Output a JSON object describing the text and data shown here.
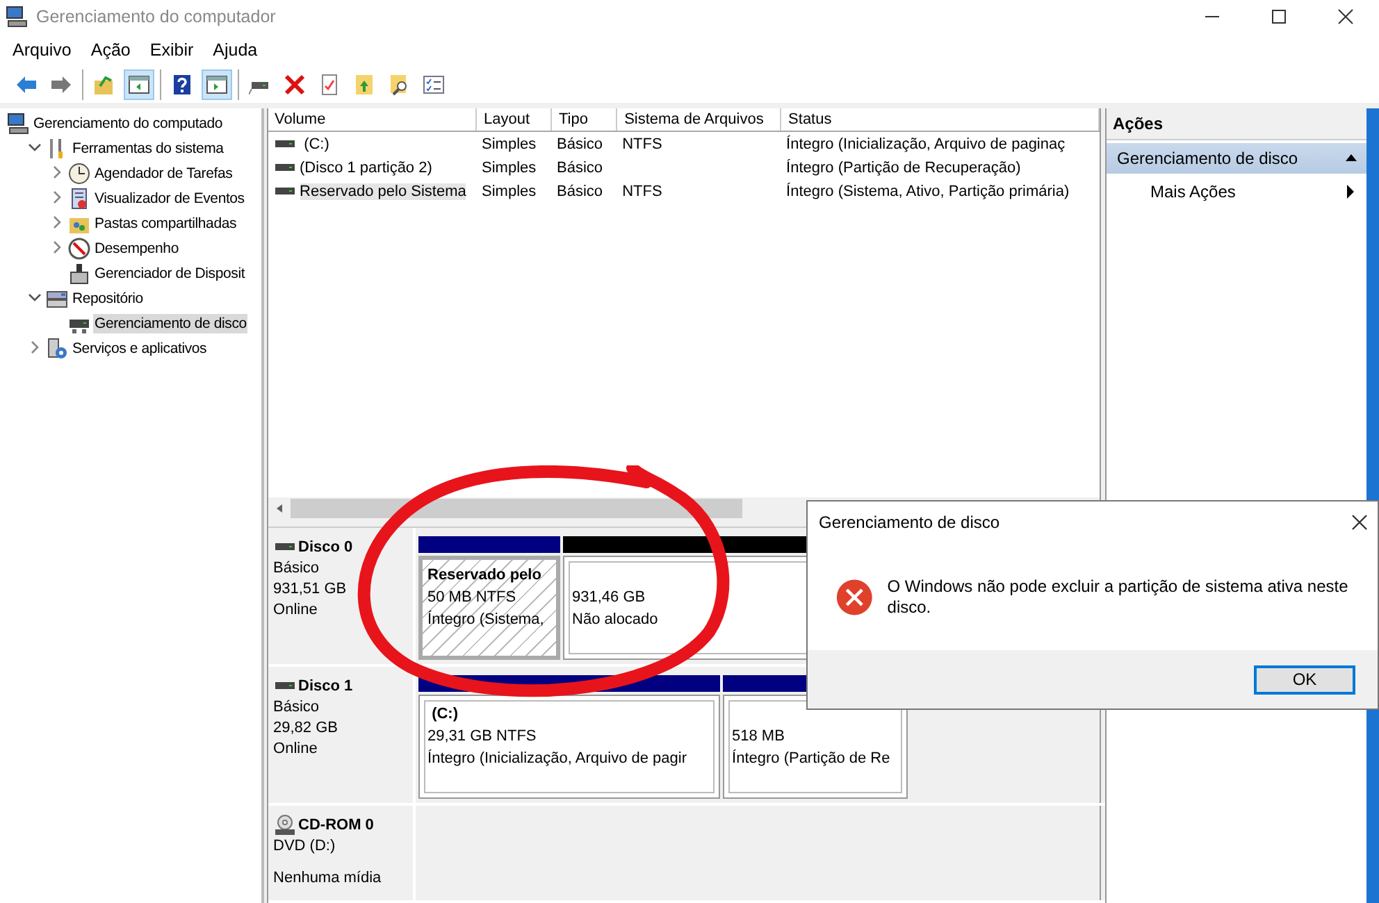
{
  "window": {
    "title": "Gerenciamento do computador"
  },
  "menu": [
    "Arquivo",
    "Ação",
    "Exibir",
    "Ajuda"
  ],
  "toolbar": [
    [
      {
        "kind": "back",
        "pressed": false
      },
      {
        "kind": "forward",
        "pressed": false
      }
    ],
    [
      {
        "kind": "up",
        "pressed": false
      },
      {
        "kind": "tree-pane",
        "pressed": true
      }
    ],
    [
      {
        "kind": "help",
        "pressed": false
      },
      {
        "kind": "action-pane",
        "pressed": true
      }
    ],
    [
      {
        "kind": "connect",
        "pressed": false
      },
      {
        "kind": "delete",
        "pressed": false
      },
      {
        "kind": "properties",
        "pressed": false
      },
      {
        "kind": "export",
        "pressed": false
      },
      {
        "kind": "find",
        "pressed": false
      },
      {
        "kind": "checklist",
        "pressed": false
      }
    ]
  ],
  "tree": [
    {
      "label": "Gerenciamento do computado",
      "kind": "computer",
      "selected": false,
      "children": [
        {
          "label": "Ferramentas do sistema",
          "kind": "tools",
          "expanded": true,
          "selected": false,
          "children": [
            {
              "label": "Agendador de Tarefas",
              "kind": "clock",
              "expanded": false,
              "selected": false
            },
            {
              "label": "Visualizador de Eventos",
              "kind": "log",
              "expanded": false,
              "selected": false
            },
            {
              "label": "Pastas compartilhadas",
              "kind": "share",
              "expanded": false,
              "selected": false
            },
            {
              "label": "Desempenho",
              "kind": "gauge",
              "expanded": false,
              "selected": false
            },
            {
              "label": "Gerenciador de Disposit",
              "kind": "device",
              "selected": false
            }
          ]
        },
        {
          "label": "Repositório",
          "kind": "storage",
          "expanded": true,
          "selected": false,
          "children": [
            {
              "label": "Gerenciamento de disco",
              "kind": "disk",
              "selected": true
            }
          ]
        },
        {
          "label": "Serviços e aplicativos",
          "kind": "services",
          "expanded": false,
          "selected": false
        }
      ]
    }
  ],
  "volume_table": {
    "columns": [
      "Volume",
      "Layout",
      "Tipo",
      "Sistema de Arquivos",
      "Status"
    ],
    "rows": [
      {
        "volume": " (C:)",
        "layout": "Simples",
        "type": "Básico",
        "file_system": "NTFS",
        "status": "Íntegro (Inicialização, Arquivo de paginaç",
        "selected": false
      },
      {
        "volume": "(Disco 1 partição 2)",
        "layout": "Simples",
        "type": "Básico",
        "status": "Íntegro (Partição de Recuperação)",
        "selected": false
      },
      {
        "volume": "Reservado pelo Sistema",
        "layout": "Simples",
        "type": "Básico",
        "file_system": "NTFS",
        "status": "Íntegro (Sistema, Ativo, Partição primária)",
        "selected": true
      }
    ]
  },
  "disks": [
    {
      "kind": "disk",
      "name": "Disco 0",
      "details": [
        "Básico",
        "931,51 GB",
        "Online"
      ],
      "partitions": [
        {
          "kind": "primary",
          "label": "Reservado pelo",
          "size": "50 MB NTFS",
          "status": "Íntegro (Sistema,",
          "selected": true
        },
        {
          "kind": "unallocated",
          "size": "931,46 GB",
          "status": "Não alocado",
          "selected": false
        }
      ]
    },
    {
      "kind": "disk",
      "name": "Disco 1",
      "details": [
        "Básico",
        "29,82 GB",
        "Online"
      ],
      "partitions": [
        {
          "kind": "primary",
          "label": " (C:)",
          "size": "29,31 GB NTFS",
          "status": "Íntegro (Inicialização, Arquivo de pagir",
          "selected": false
        },
        {
          "kind": "primary",
          "size": "518 MB",
          "status": "Íntegro (Partição de Re",
          "selected": false
        }
      ]
    },
    {
      "kind": "cdrom",
      "name": "CD-ROM 0",
      "details": [
        "DVD (D:)"
      ],
      "media": "Nenhuma mídia"
    }
  ],
  "actions": {
    "title": "Ações",
    "items": [
      {
        "kind": "header",
        "label": "Gerenciamento de disco"
      },
      {
        "kind": "submenu",
        "label": "Mais Ações"
      }
    ]
  },
  "dialog": {
    "title": "Gerenciamento de disco",
    "message": "O Windows não pode excluir a partição de sistema ativa neste disco.",
    "buttons": [
      "OK"
    ]
  }
}
